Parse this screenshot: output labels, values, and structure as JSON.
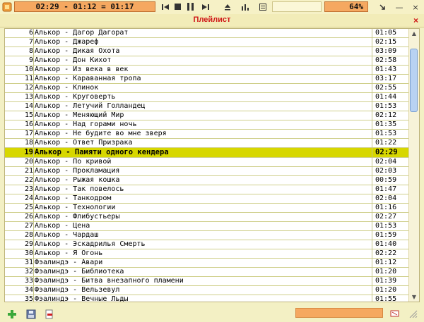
{
  "player": {
    "time_display": "02:29 - 01:12 = 01:17",
    "volume": "64%"
  },
  "playlist": {
    "title": "Плейлист",
    "close_symbol": "×",
    "active_index": 13,
    "tracks": [
      {
        "num": "6",
        "name": "Алькор - Дагор Дагорат",
        "dur": "01:05"
      },
      {
        "num": "7",
        "name": "Алькор - Джареф",
        "dur": "02:15"
      },
      {
        "num": "8",
        "name": "Алькор - Дикая Охота",
        "dur": "03:09"
      },
      {
        "num": "9",
        "name": "Алькор - Дон Кихот",
        "dur": "02:58"
      },
      {
        "num": "10",
        "name": "Алькор - Из века в век",
        "dur": "01:43"
      },
      {
        "num": "11",
        "name": "Алькор - Караванная тропа",
        "dur": "03:17"
      },
      {
        "num": "12",
        "name": "Алькор - Клинок",
        "dur": "02:55"
      },
      {
        "num": "13",
        "name": "Алькор - Круговерть",
        "dur": "01:44"
      },
      {
        "num": "14",
        "name": "Алькор - Летучий Голландец",
        "dur": "01:53"
      },
      {
        "num": "15",
        "name": "Алькор - Меняющий Мир",
        "dur": "02:12"
      },
      {
        "num": "16",
        "name": "Алькор - Над горами ночь",
        "dur": "01:35"
      },
      {
        "num": "17",
        "name": "Алькор - Не будите во мне зверя",
        "dur": "01:53"
      },
      {
        "num": "18",
        "name": "Алькор - Ответ Призрака",
        "dur": "01:22"
      },
      {
        "num": "19",
        "name": "Алькор - Памяти одного кендера",
        "dur": "02:29"
      },
      {
        "num": "20",
        "name": "Алькор - По кривой",
        "dur": "02:04"
      },
      {
        "num": "21",
        "name": "Алькор - Прокламация",
        "dur": "02:03"
      },
      {
        "num": "22",
        "name": "Алькор - Рыжая кошка",
        "dur": "00:59"
      },
      {
        "num": "23",
        "name": "Алькор - Так повелось",
        "dur": "01:47"
      },
      {
        "num": "24",
        "name": "Алькор - Танкодром",
        "dur": "02:04"
      },
      {
        "num": "25",
        "name": "Алькор - Технологии",
        "dur": "01:16"
      },
      {
        "num": "26",
        "name": "Алькор - Флибустьеры",
        "dur": "02:27"
      },
      {
        "num": "27",
        "name": "Алькор - Цена",
        "dur": "01:53"
      },
      {
        "num": "28",
        "name": "Алькор - Чардаш",
        "dur": "01:59"
      },
      {
        "num": "29",
        "name": "Алькор - Эскадрилья Смерть",
        "dur": "01:40"
      },
      {
        "num": "30",
        "name": "Алькор - Я Огонь",
        "dur": "02:22"
      },
      {
        "num": "31",
        "name": "Фэалиндэ - Авари",
        "dur": "01:12"
      },
      {
        "num": "32",
        "name": "Фэалиндэ - Библиотека",
        "dur": "01:20"
      },
      {
        "num": "33",
        "name": "Фэалиндэ - Битва внезапного пламени",
        "dur": "01:39"
      },
      {
        "num": "34",
        "name": "Фэалиндэ - Вельзевул",
        "dur": "01:20"
      },
      {
        "num": "35",
        "name": "Фэалиндэ - Вечные Льды",
        "dur": "01:55"
      }
    ]
  },
  "icons": {
    "app": "app-logo-icon",
    "prev": "prev-track-icon",
    "stop": "stop-icon",
    "pause": "pause-icon",
    "next": "next-track-icon",
    "equalizer": "equalizer-icon",
    "playlist_toggle": "playlist-toggle-icon",
    "minimize": "minimize-icon",
    "add": "add-icon",
    "save": "save-icon",
    "remove": "remove-file-icon"
  },
  "colors": {
    "accent_orange": "#f5a860",
    "active_row": "#d7d700",
    "title_red": "#d01818",
    "background": "#f3f0c4"
  }
}
